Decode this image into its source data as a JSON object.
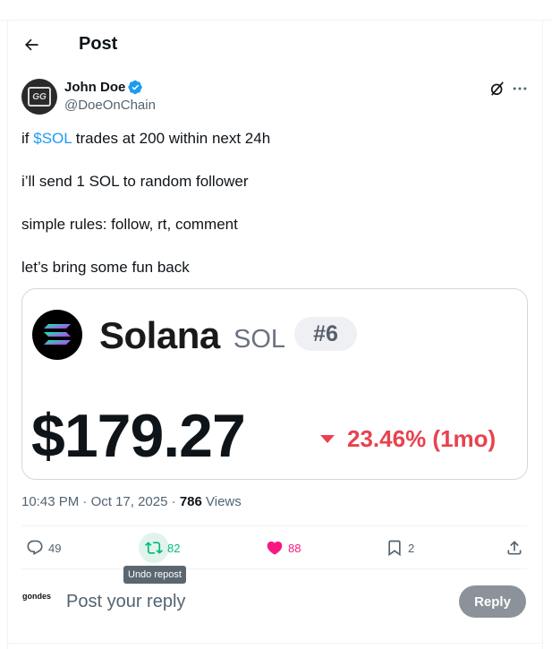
{
  "header": {
    "title": "Post",
    "back_icon": "arrow-left-icon"
  },
  "author": {
    "avatar_text": "GG",
    "display_name": "John Doe",
    "handle": "@DoeOnChain",
    "verified": true,
    "verified_color": "#1d9bf0",
    "icons": [
      "verified-badge-icon",
      "grok-icon",
      "more-icon"
    ]
  },
  "tweet": {
    "line1_prefix": "if ",
    "line1_cashtag": "$SOL",
    "line1_suffix": " trades at 200 within next 24h",
    "line2": "i’ll send 1 SOL to random follower",
    "line3": "simple rules: follow, rt, comment",
    "line4": "let’s bring some fun back"
  },
  "card": {
    "coin_name": "Solana",
    "coin_symbol": "SOL",
    "rank": "#6",
    "price": "$179.27",
    "change": "23.46% (1mo)",
    "change_direction": "down",
    "change_color": "#e8424f"
  },
  "meta": {
    "time": "10:43 PM",
    "separator": " · ",
    "date": "Oct 17, 2025",
    "views_count": "786",
    "views_label": " Views"
  },
  "actions": {
    "replies": "49",
    "reposts": "82",
    "likes": "88",
    "bookmarks": "2",
    "repost_color": "#00ba7c",
    "like_color": "#f91880"
  },
  "tooltip": {
    "text": "Undo repost"
  },
  "reply_box": {
    "avatar_text": "gondes",
    "placeholder": "Post your reply",
    "button_label": "Reply"
  }
}
